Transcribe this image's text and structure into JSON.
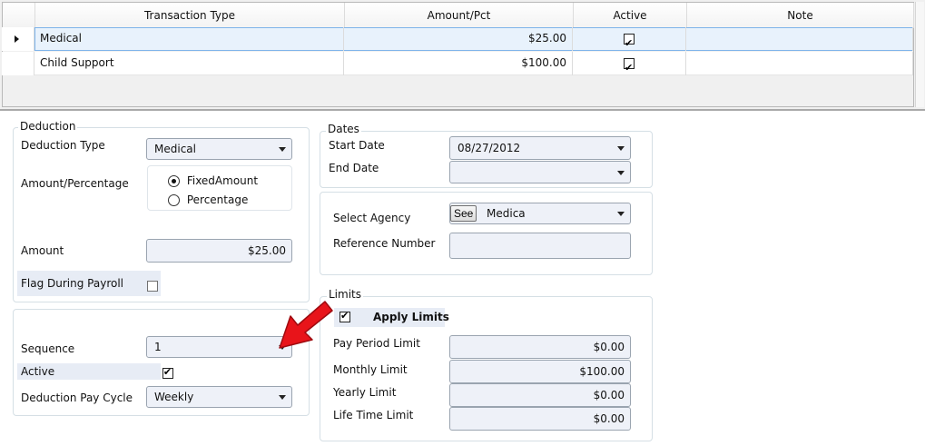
{
  "grid": {
    "columns": [
      "Transaction Type",
      "Amount/Pct",
      "Active",
      "Note"
    ],
    "rows": [
      {
        "type": "Medical",
        "amount": "$25.00",
        "active": true,
        "note": ""
      },
      {
        "type": "Child Support",
        "amount": "$100.00",
        "active": true,
        "note": ""
      }
    ],
    "selected_row": 0
  },
  "deduction": {
    "legend": "Deduction",
    "type_label": "Deduction Type",
    "type_value": "Medical",
    "amount_pct_label": "Amount/Percentage",
    "radio_fixed": "FixedAmount",
    "radio_pct": "Percentage",
    "radio_selected": "FixedAmount",
    "amount_label": "Amount",
    "amount_value": "$25.00",
    "flag_label": "Flag During Payroll",
    "flag_checked": false
  },
  "sequence_group": {
    "sequence_label": "Sequence",
    "sequence_value": "1",
    "active_label": "Active",
    "active_checked": true,
    "pay_cycle_label": "Deduction Pay Cycle",
    "pay_cycle_value": "Weekly"
  },
  "dates": {
    "legend": "Dates",
    "start_label": "Start Date",
    "start_value": "08/27/2012",
    "end_label": "End Date",
    "end_value": ""
  },
  "agency": {
    "select_label": "Select Agency",
    "see_button": "See",
    "agency_value": "Medica",
    "reference_label": "Reference Number",
    "reference_value": ""
  },
  "limits": {
    "legend": "Limits",
    "apply_label": "Apply Limits",
    "apply_checked": true,
    "pay_period_label": "Pay Period Limit",
    "pay_period_value": "$0.00",
    "monthly_label": "Monthly Limit",
    "monthly_value": "$100.00",
    "yearly_label": "Yearly Limit",
    "yearly_value": "$0.00",
    "lifetime_label": "Life Time Limit",
    "lifetime_value": "$0.00"
  },
  "colors": {
    "annotation_arrow": "#e8141a",
    "selection_border": "#7eb4ea",
    "selection_fill": "#e8f2fc",
    "field_fill": "#eef1f8"
  }
}
